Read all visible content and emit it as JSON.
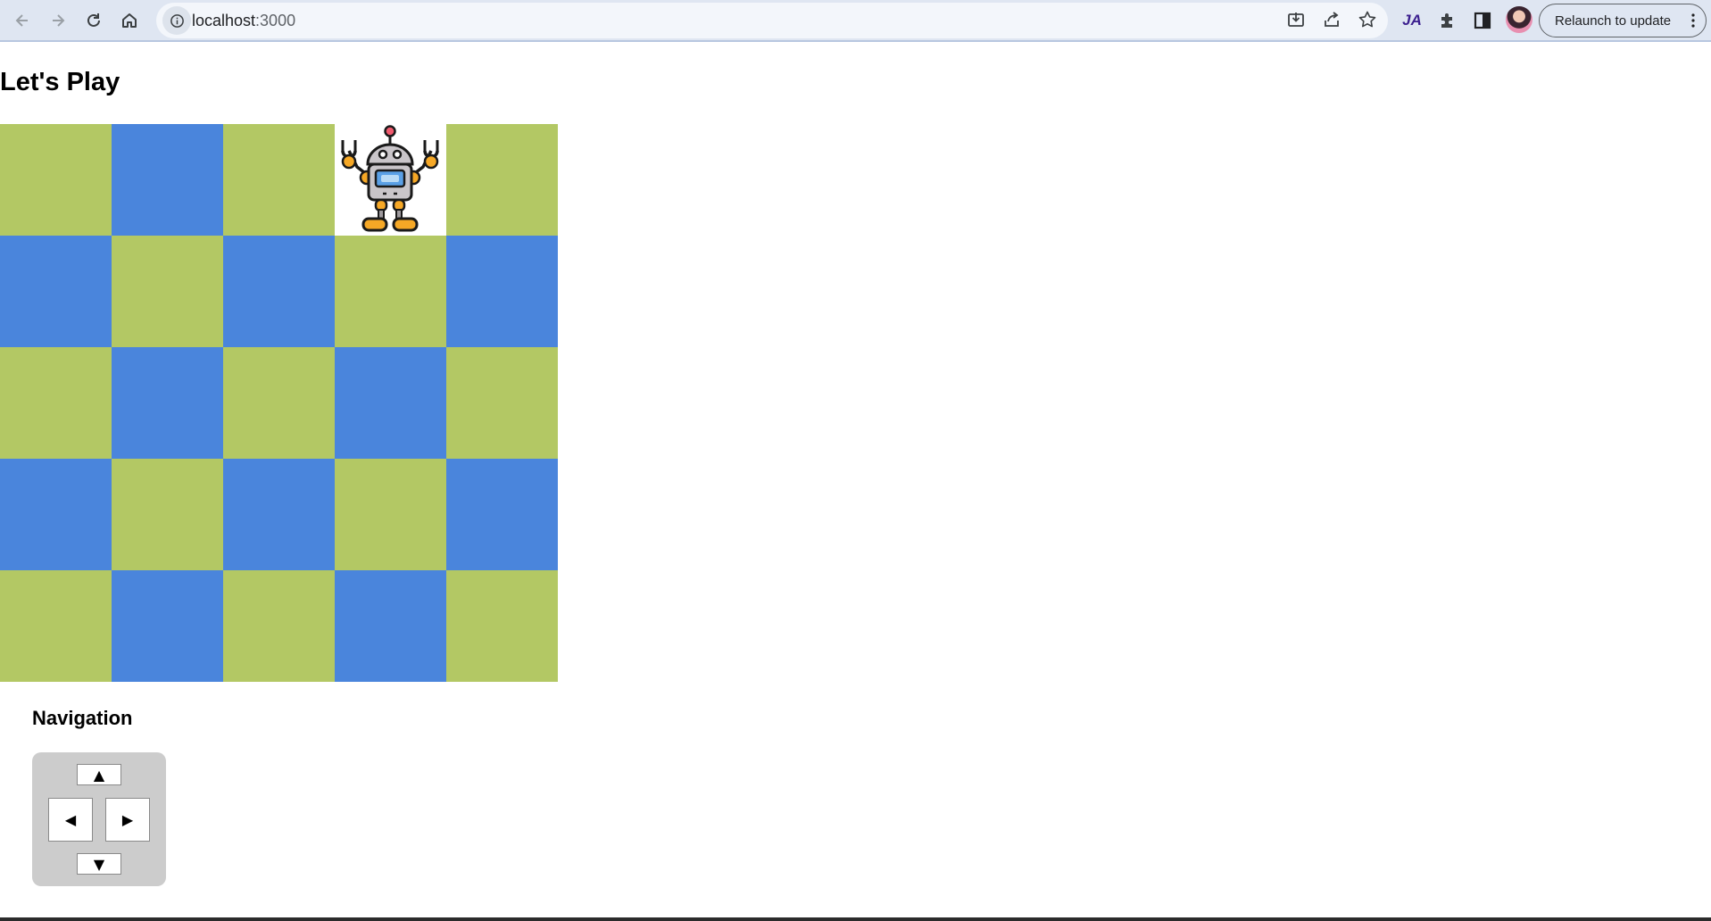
{
  "browser": {
    "url_host": "localhost",
    "url_port": ":3000",
    "extension_label": "JA",
    "relaunch_label": "Relaunch to update"
  },
  "page": {
    "title": "Let's Play",
    "navigation_title": "Navigation"
  },
  "board": {
    "rows": 5,
    "cols": 5,
    "colors": {
      "green": "#b3c864",
      "blue": "#4a85dc",
      "robot_cell": "#ffffff"
    },
    "robot_position": {
      "row": 0,
      "col": 3
    }
  },
  "controls": {
    "up": "▲",
    "left": "◀",
    "right": "▶",
    "down": "▼"
  }
}
